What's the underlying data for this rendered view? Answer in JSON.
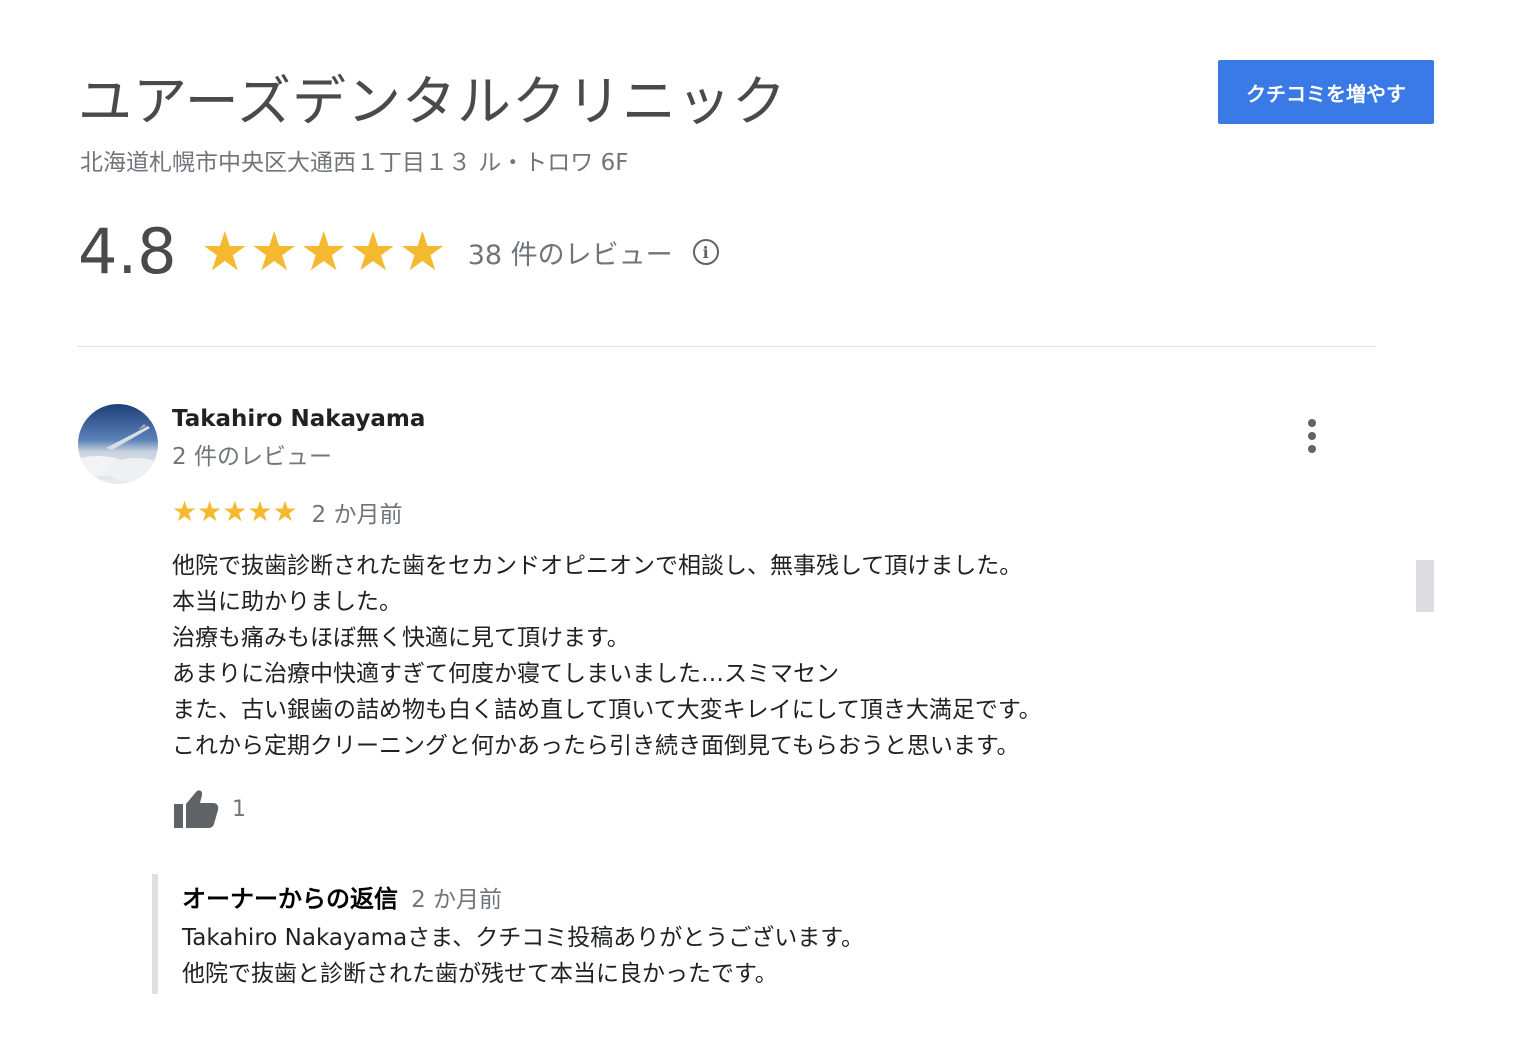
{
  "business": {
    "name": "ユアーズデンタルクリニック",
    "address": "北海道札幌市中央区大通西１丁目１３ ル・トロワ 6F",
    "cta_label": "クチコミを増やす",
    "rating": "4.8",
    "stars": 5,
    "review_count_label": "38 件のレビュー",
    "info_icon": "info-icon"
  },
  "colors": {
    "accent": "#3a7ae6",
    "star": "#f5b92f",
    "muted_text": "#70757a"
  },
  "review": {
    "reviewer_name": "Takahiro Nakayama",
    "reviewer_review_count": "2 件のレビュー",
    "stars": 5,
    "date": "2 か月前",
    "body_lines": [
      "他院で抜歯診断された歯をセカンドオピニオンで相談し、無事残して頂けました。",
      "本当に助かりました。",
      "治療も痛みもほぼ無く快適に見て頂けます。",
      "あまりに治療中快適すぎて何度か寝てしまいました…スミマセン",
      "また、古い銀歯の詰め物も白く詰め直して頂いて大変キレイにして頂き大満足です。",
      "これから定期クリーニングと何かあったら引き続き面倒見てもらおうと思います。"
    ],
    "like_count": "1",
    "owner_reply": {
      "label": "オーナーからの返信",
      "date": "2 か月前",
      "body_lines": [
        "Takahiro Nakayamaさま、クチコミ投稿ありがとうございます。",
        "他院で抜歯と診断された歯が残せて本当に良かったです。"
      ]
    }
  }
}
